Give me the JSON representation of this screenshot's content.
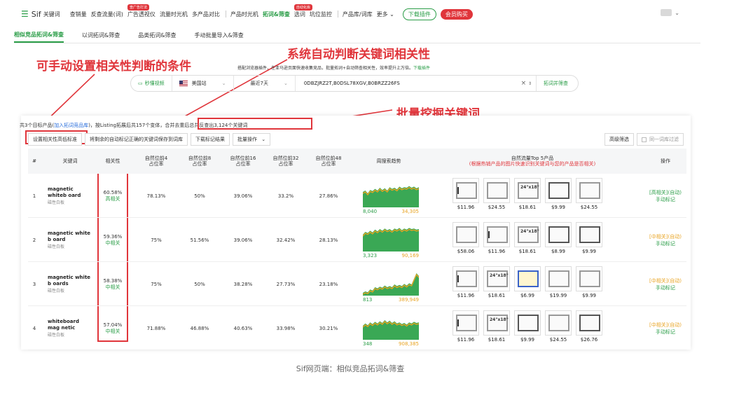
{
  "nav": {
    "logo_mark": "☰",
    "logo": "Sif",
    "logo_sub": "关键词",
    "items": [
      {
        "label": "查销量",
        "badge": ""
      },
      {
        "label": "反查流量(词)",
        "badge": ""
      },
      {
        "label": "广告透视仪",
        "badge": "查广告打法"
      },
      {
        "label": "流量时光机",
        "badge": ""
      },
      {
        "label": "多产品对比",
        "badge": ""
      }
    ],
    "items2": [
      {
        "label": "产品时光机",
        "badge": "",
        "green": false
      },
      {
        "label": "拓词&筛查",
        "badge": "",
        "green": true
      },
      {
        "label": "选词",
        "badge": "自动化库",
        "green": false
      },
      {
        "label": "坑位监控",
        "badge": "",
        "green": false
      }
    ],
    "items3": [
      "产品库/词库",
      "更多"
    ],
    "download": "下载插件",
    "vip": "会员购买"
  },
  "subtabs": [
    "相似竞品拓词&筛查",
    "以词拓词&筛查",
    "品类拓词&筛查",
    "手动批量导入&筛查"
  ],
  "annotations": {
    "left": "可手动设置相关性判断的条件",
    "center": "系统自动判断关键词相关性",
    "right": "批量挖掘关键词"
  },
  "hint": {
    "text": "搭配浏览器插件，在亚马逊页面快速收集竞品，批量拓词+自动筛查相关性，效率提升上万倍。",
    "link": "下载插件"
  },
  "search": {
    "quick": "秒懂视频",
    "site": "美国站",
    "period": "最近7天",
    "asins": "0DBZJRZ2T,B0DSL78XGV,B0BRZZ26FS",
    "submit": "拓词并筛查"
  },
  "summary": {
    "p1": "共",
    "p2": "3个目标产品(",
    "link": "加入拓词竞品库",
    "p3": ")，按Listing拓展后共157个变体，",
    "p4": "合并去重后总共反查出3,124个关键词"
  },
  "toolbar": {
    "relevance": "设置相关性高低标准",
    "save": "将剩余的自动标记正确的关键词保存到词库",
    "download": "下载标记结果",
    "batch": "批量操作",
    "advanced": "高级筛选",
    "samefilter": "同一词库过滤"
  },
  "headers": {
    "idx": "#",
    "kw": "关键词",
    "rel": "相关性",
    "n4": [
      "自然位前4",
      "占位率"
    ],
    "n8": [
      "自然位前8",
      "占位率"
    ],
    "n16": [
      "自然位前16",
      "占位率"
    ],
    "n32": [
      "自然位前32",
      "占位率"
    ],
    "n48": [
      "自然位前48",
      "占位率"
    ],
    "trend": "周搜索趋势",
    "top5": "自然流量Top 5产品",
    "top5sub": "(根据热销产品的图片快速识别关键词与您的产品是否相关)",
    "ops": "操作"
  },
  "rows": [
    {
      "idx": "1",
      "kw": "magnetic whiteb oard",
      "cn": "磁性白板",
      "rel": "60.58%",
      "lvl": "高相关",
      "n4": "78.13%",
      "n8": "50%",
      "n16": "39.06%",
      "n32": "33.2%",
      "n48": "27.86%",
      "lo": "8,040",
      "hi": "34,305",
      "prices": [
        "$11.96",
        "$24.55",
        "$18.61",
        "$9.99",
        "$24.55"
      ],
      "act1": "[高相关](自动)",
      "act2": "手动标记",
      "mid": false
    },
    {
      "idx": "2",
      "kw": "magnetic white b oard",
      "cn": "磁性白板",
      "rel": "59.36%",
      "lvl": "中相关",
      "n4": "75%",
      "n8": "51.56%",
      "n16": "39.06%",
      "n32": "32.42%",
      "n48": "28.13%",
      "lo": "3,323",
      "hi": "90,169",
      "prices": [
        "$58.06",
        "$11.96",
        "$18.61",
        "$8.99",
        "$9.99"
      ],
      "act1": "[中相关](自动)",
      "act2": "手动标记",
      "mid": true
    },
    {
      "idx": "3",
      "kw": "magnetic white b oards",
      "cn": "磁性白板",
      "rel": "58.38%",
      "lvl": "中相关",
      "n4": "75%",
      "n8": "50%",
      "n16": "38.28%",
      "n32": "27.73%",
      "n48": "23.18%",
      "lo": "813",
      "hi": "389,949",
      "prices": [
        "$11.96",
        "$18.61",
        "$6.99",
        "$19.99",
        "$9.99"
      ],
      "act1": "[中相关](自动)",
      "act2": "手动标记",
      "mid": true
    },
    {
      "idx": "4",
      "kw": "whiteboard mag netic",
      "cn": "磁性白板",
      "rel": "57.04%",
      "lvl": "中相关",
      "n4": "71.88%",
      "n8": "46.88%",
      "n16": "40.63%",
      "n32": "33.98%",
      "n48": "30.21%",
      "lo": "348",
      "hi": "908,385",
      "prices": [
        "$11.96",
        "$18.61",
        "$9.99",
        "$24.55",
        "$26.76"
      ],
      "act1": "[中相关](自动)",
      "act2": "手动标记",
      "mid": true
    }
  ],
  "product_tag": "24\"x18\"",
  "caption": "Sif网页端：相似竞品拓词&筛查",
  "colors": {
    "green": "#2a9d47",
    "red": "#e0353b",
    "orange": "#e8a321"
  }
}
